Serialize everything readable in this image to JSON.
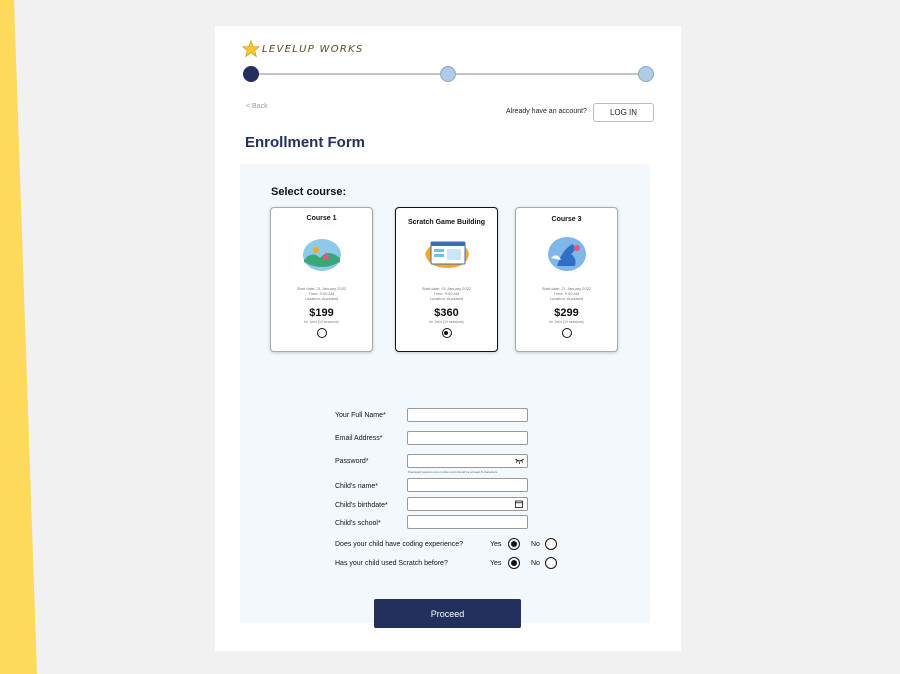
{
  "brand": {
    "name": "LEVELUP WORKS"
  },
  "nav": {
    "back_label": "< Back",
    "have_account": "Already have an account?",
    "login_label": "LOG IN"
  },
  "page_title": "Enrollment Form",
  "select_course_label": "Select course:",
  "courses": [
    {
      "name": "Course 1",
      "start": "Start date: 21 January 2022",
      "time": "Time: 9:00 AM",
      "location": "Location: Auckland",
      "price": "$199",
      "note": "for 1min (10 sessions)",
      "selected": false
    },
    {
      "name": "Scratch Game Building",
      "start": "Start date: 01 January 2022",
      "time": "Time: 9:00 AM",
      "location": "Location: Auckland",
      "price": "$360",
      "note": "for 1min (10 sessions)",
      "selected": true
    },
    {
      "name": "Course 3",
      "start": "Start date: 21 January 2022",
      "time": "Time: 9:00 AM",
      "location": "Location: Auckland",
      "price": "$299",
      "note": "for 1min (10 sessions)",
      "selected": false
    }
  ],
  "form": {
    "full_name_label": "Your Full Name*",
    "email_label": "Email Address*",
    "password_label": "Password*",
    "password_hint": "Password requires one number and should be at least 8 characters",
    "child_name_label": "Child's name*",
    "child_birthdate_label": "Child's birthdate*",
    "child_school_label": "Child's school*",
    "q_coding": "Does your child have coding experience?",
    "q_scratch": "Has your child used Scratch before?",
    "yes": "Yes",
    "no": "No",
    "coding_answer": "Yes",
    "scratch_answer": "Yes"
  },
  "proceed_label": "Proceed",
  "colors": {
    "primary": "#232f5c",
    "step_inactive": "#afcbe5",
    "panel_bg": "#f3f8fd",
    "accent_yellow": "#fdd95c"
  }
}
